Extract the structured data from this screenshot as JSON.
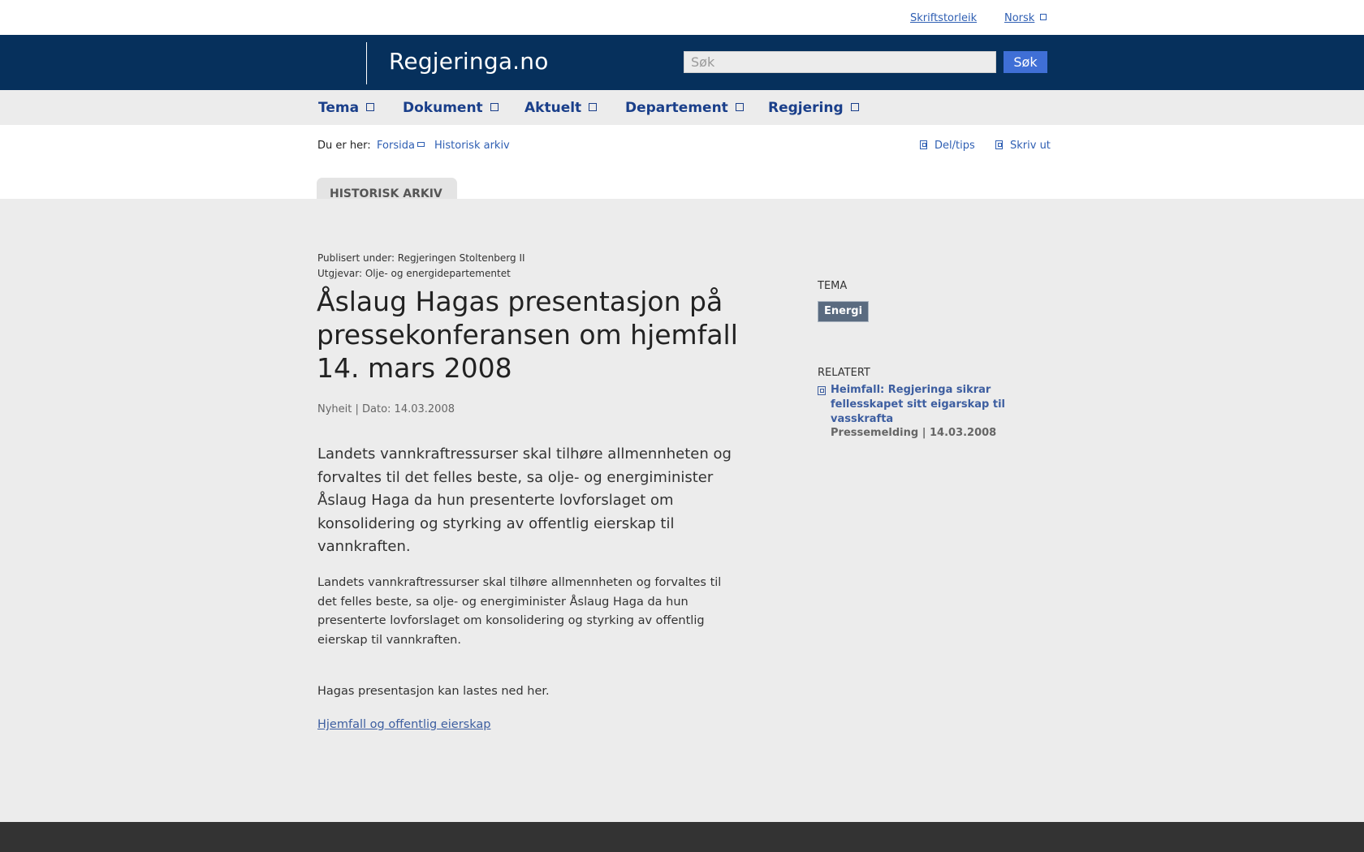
{
  "topbar": {
    "font_size_link": "Skriftstorleik",
    "language_link": "Norsk"
  },
  "header": {
    "brand": "Regjeringa.no",
    "search_placeholder": "Søk",
    "search_button": "Søk"
  },
  "nav": {
    "items": [
      {
        "label": "Tema"
      },
      {
        "label": "Dokument"
      },
      {
        "label": "Aktuelt"
      },
      {
        "label": "Departement"
      },
      {
        "label": "Regjering"
      }
    ]
  },
  "breadcrumb": {
    "label": "Du er her:",
    "items": [
      {
        "label": "Forsida"
      },
      {
        "label": "Historisk arkiv"
      }
    ]
  },
  "tools": {
    "share": "Del/tips",
    "print": "Skriv ut"
  },
  "tab": {
    "label": "HISTORISK ARKIV"
  },
  "article": {
    "published_under": "Publisert under: Regjeringen Stoltenberg II",
    "publisher": "Utgjevar: Olje- og energidepartementet",
    "title": "Åslaug Hagas presentasjon på pressekonferansen om hjemfall 14. mars 2008",
    "dateline": "Nyheit | Dato: 14.03.2008",
    "lead": "Landets vannkraftressurser skal tilhøre allmennheten og forvaltes til det felles beste, sa olje- og energiminister Åslaug Haga da hun presenterte lovforslaget om konsolidering og styrking av offentlig eierskap til vannkraften.",
    "body": "Landets vannkraftressurser skal tilhøre allmennheten og forvaltes til det felles beste, sa olje- og energiminister Åslaug Haga da hun presenterte lovforslaget om konsolidering og styrking av offentlig eierskap til vannkraften.",
    "download_text": "Hagas presentasjon kan lastes ned her.",
    "download_link": "Hjemfall og offentlig eierskap"
  },
  "sidebar": {
    "tema_label": "TEMA",
    "tema_tag": "Energi",
    "related_label": "RELATERT",
    "related_link": "Heimfall: Regjeringa sikrar fellesskapet sitt eigarskap til vasskrafta",
    "related_meta": "Pressemelding | 14.03.2008"
  },
  "colors": {
    "header_bg": "#06305c",
    "link": "#2f5fb3",
    "nav_text": "#1a3f8a",
    "search_button": "#3f6fd6",
    "tag_bg": "#5a6b80",
    "footer_bg": "#333333"
  }
}
